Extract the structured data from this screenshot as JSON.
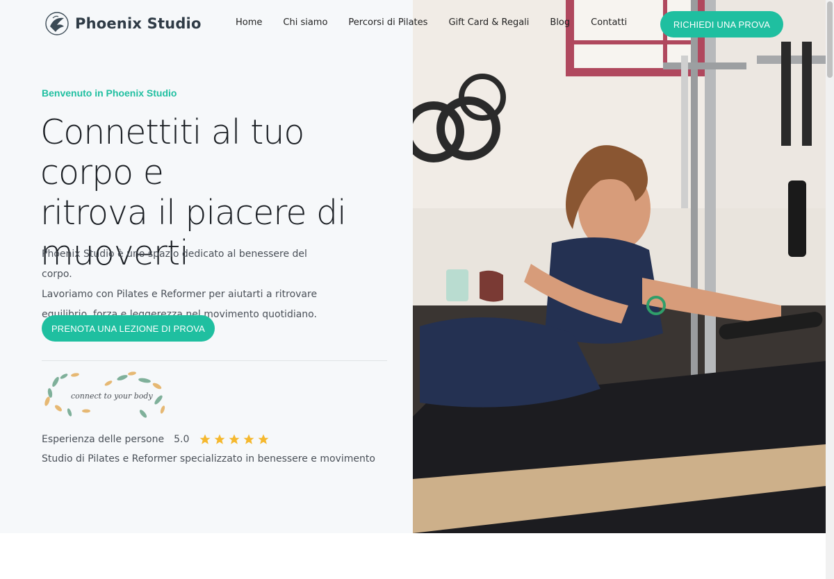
{
  "header": {
    "logo_text": "Phoenix Studio",
    "nav": [
      "Home",
      "Chi siamo",
      "Percorsi di Pilates",
      "Gift Card & Regali",
      "Blog",
      "Contatti"
    ],
    "cta_label": "RICHIEDI UNA PROVA"
  },
  "hero": {
    "eyebrow": "Benvenuto in Phoenix Studio",
    "headline_lines": [
      "Connettiti al tuo corpo e",
      "ritrova il piacere di",
      "muoverti"
    ],
    "intro_lines": [
      "Phoenix Studio è uno spazio dedicato al benessere del corpo.",
      "Lavoriamo con Pilates e Reformer per aiutarti a ritrovare",
      "equilibrio, forza e leggerezza nel movimento quotidiano."
    ],
    "cta_label": "PRENOTA UNA LEZIONE DI PROVA",
    "badge_text": "connect to your body",
    "rating_label": "Esperienza delle persone",
    "rating_score": "5.0",
    "rating_stars": 5,
    "tagline": "Studio di Pilates e Reformer specializzato in benessere e movimento"
  },
  "colors": {
    "accent": "#1fbfa0",
    "star": "#f5b82e",
    "hero_bg": "#f6f8fa",
    "heading": "#1b1f24"
  }
}
